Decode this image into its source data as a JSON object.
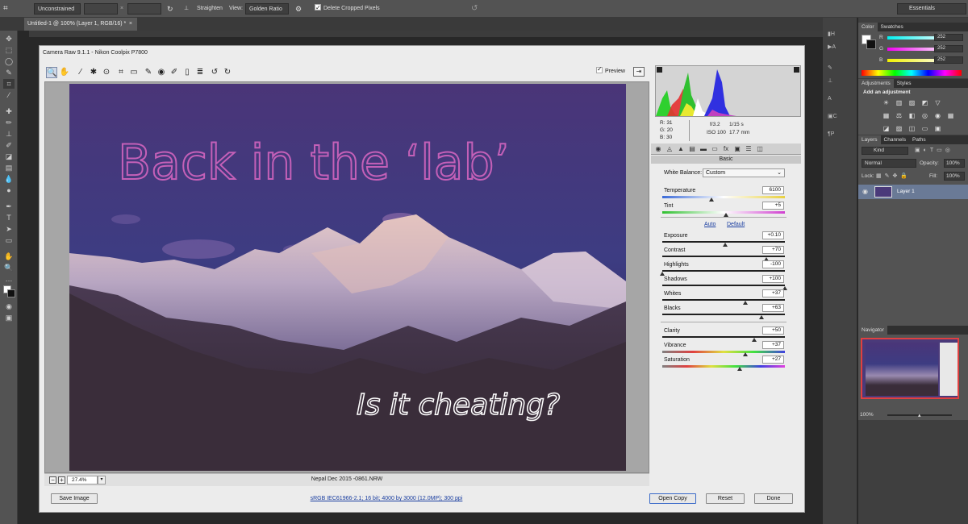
{
  "optbar": {
    "ratio": "Unconstrained",
    "straighten": "Straighten",
    "view_label": "View:",
    "view": "Golden Ratio",
    "delete_cropped": "Delete Cropped Pixels",
    "workspace": "Essentials"
  },
  "doc_tab": {
    "title": "Untitled-1 @ 100% (Layer 1, RGB/16) *",
    "close": "×"
  },
  "dialog": {
    "title": "Camera Raw 9.1.1  -  Nikon Coolpix P7800",
    "preview_label": "Preview",
    "photo_title": "Back in the ‘lab’",
    "photo_subtitle": "Is it cheating?",
    "zoom": "27.4%",
    "filename": "Nepal Dec 2015 -0861.NRW",
    "workflow": "sRGB IEC61966-2.1; 16 bit; 4000 by 3000 (12.0MP); 300 ppi",
    "buttons": {
      "save": "Save Image",
      "open_copy": "Open Copy",
      "reset": "Reset",
      "done": "Done"
    }
  },
  "readout": {
    "r": "R:",
    "r_val": "31",
    "g": "G:",
    "g_val": "20",
    "b": "B:",
    "b_val": "30",
    "aperture": "f/3.2",
    "shutter": "1/15 s",
    "iso": "ISO 100",
    "focal": "17.7 mm"
  },
  "basic": {
    "header": "Basic",
    "white_balance_label": "White Balance:",
    "white_balance": "Custom",
    "auto": "Auto",
    "default": "Default",
    "sliders": [
      {
        "label": "Temperature",
        "value": "6100",
        "pos": 0.4,
        "track": "temp"
      },
      {
        "label": "Tint",
        "value": "+5",
        "pos": 0.52,
        "track": "tint"
      },
      {
        "label": "Exposure",
        "value": "+0.10",
        "pos": 0.51,
        "track": "gray"
      },
      {
        "label": "Contrast",
        "value": "+70",
        "pos": 0.85,
        "track": "gray"
      },
      {
        "label": "Highlights",
        "value": "-100",
        "pos": 0.0,
        "track": "gray"
      },
      {
        "label": "Shadows",
        "value": "+100",
        "pos": 1.0,
        "track": "gray"
      },
      {
        "label": "Whites",
        "value": "+37",
        "pos": 0.68,
        "track": "gray"
      },
      {
        "label": "Blacks",
        "value": "+63",
        "pos": 0.81,
        "track": "gray"
      },
      {
        "label": "Clarity",
        "value": "+50",
        "pos": 0.75,
        "track": "gray"
      },
      {
        "label": "Vibrance",
        "value": "+37",
        "pos": 0.68,
        "track": "vib"
      },
      {
        "label": "Saturation",
        "value": "+27",
        "pos": 0.63,
        "track": "sat"
      }
    ]
  },
  "panels": {
    "color_tab": "Color",
    "swatches_tab": "Swatches",
    "r": "R",
    "g": "G",
    "b": "B",
    "r_val": "252",
    "g_val": "252",
    "b_val": "252",
    "adjustments_tab": "Adjustments",
    "styles_tab": "Styles",
    "add_adjustment": "Add an adjustment",
    "layers_tab": "Layers",
    "channels_tab": "Channels",
    "paths_tab": "Paths",
    "kind": "Kind",
    "blend_mode": "Normal",
    "opacity_label": "Opacity:",
    "opacity": "100%",
    "lock_label": "Lock:",
    "fill_label": "Fill:",
    "fill": "100%",
    "layer_name": "Layer 1",
    "navigator_tab": "Navigator",
    "nav_zoom": "100%"
  },
  "colors": {
    "accent": "#1a3ea0",
    "photo_text": "#b55ab0"
  }
}
